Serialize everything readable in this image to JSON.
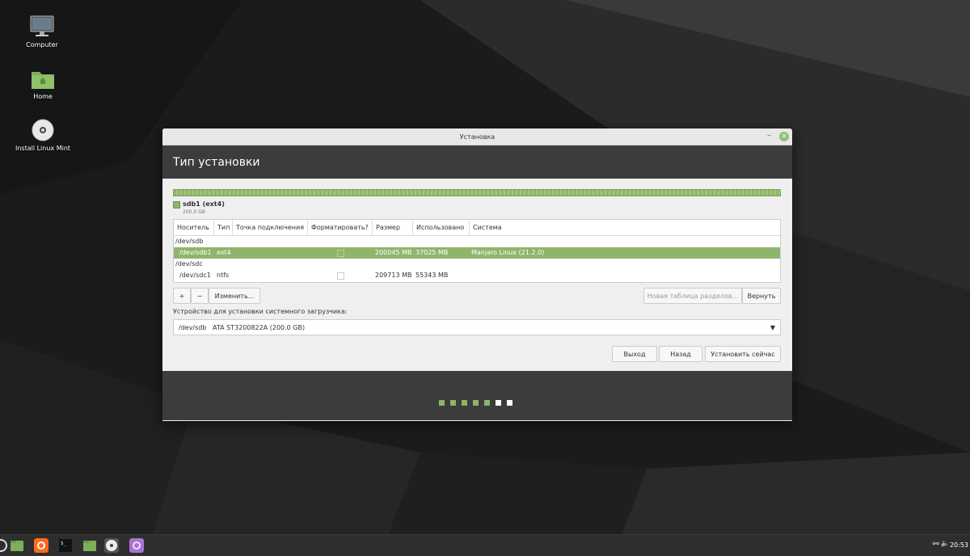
{
  "desktop": {
    "icons": [
      {
        "label": "Computer"
      },
      {
        "label": "Home"
      },
      {
        "label": "Install Linux Mint"
      }
    ]
  },
  "window": {
    "title": "Установка",
    "header": "Тип установки",
    "partition_legend": {
      "name": "sdb1 (ext4)",
      "size": "200.0 GB"
    },
    "table": {
      "columns": [
        "Носитель",
        "Тип",
        "Точка подключения",
        "Форматировать?",
        "Размер",
        "Использовано",
        "Система"
      ],
      "rows": [
        {
          "device": "/dev/sdb"
        },
        {
          "device": "/dev/sdb1",
          "type": "ext4",
          "mount": "",
          "format": false,
          "size": "200045 MB",
          "used": "37025 MB",
          "system": "Manjaro Linux (21.2.0)"
        },
        {
          "device": "/dev/sdc"
        },
        {
          "device": "/dev/sdc1",
          "type": "ntfs",
          "mount": "",
          "format": false,
          "size": "209713 MB",
          "used": "55343 MB",
          "system": ""
        }
      ]
    },
    "buttons": {
      "add": "+",
      "remove": "−",
      "change": "Изменить...",
      "new_table": "Новая таблица разделов...",
      "revert": "Вернуть",
      "quit": "Выход",
      "back": "Назад",
      "install_now": "Установить сейчас"
    },
    "bootloader": {
      "label": "Устройство для установки системного загрузчика:",
      "device": "/dev/sdb",
      "description": "ATA ST3200822A (200.0 GB)"
    },
    "progress": {
      "completed_steps": 5,
      "total_steps": 7
    }
  },
  "taskbar": {
    "clock": "20:53"
  },
  "colors": {
    "accent": "#8fb56c",
    "header": "#3c3c3c"
  }
}
